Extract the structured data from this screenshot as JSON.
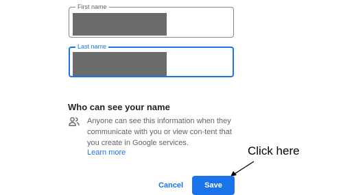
{
  "form": {
    "first_name": {
      "label": "First name",
      "value": ""
    },
    "last_name": {
      "label": "Last name",
      "value": ""
    }
  },
  "privacy": {
    "title": "Who can see your name",
    "icon": "people-icon",
    "text": "Anyone can see this information when they communicate with you or view con-tent that you create in Google services.",
    "learn_more": "Learn more"
  },
  "actions": {
    "cancel_label": "Cancel",
    "save_label": "Save"
  },
  "annotation": {
    "text": "Click here"
  },
  "colors": {
    "accent": "#1a73e8",
    "redaction": "#6b6b6b",
    "muted_text": "#5f6368"
  }
}
